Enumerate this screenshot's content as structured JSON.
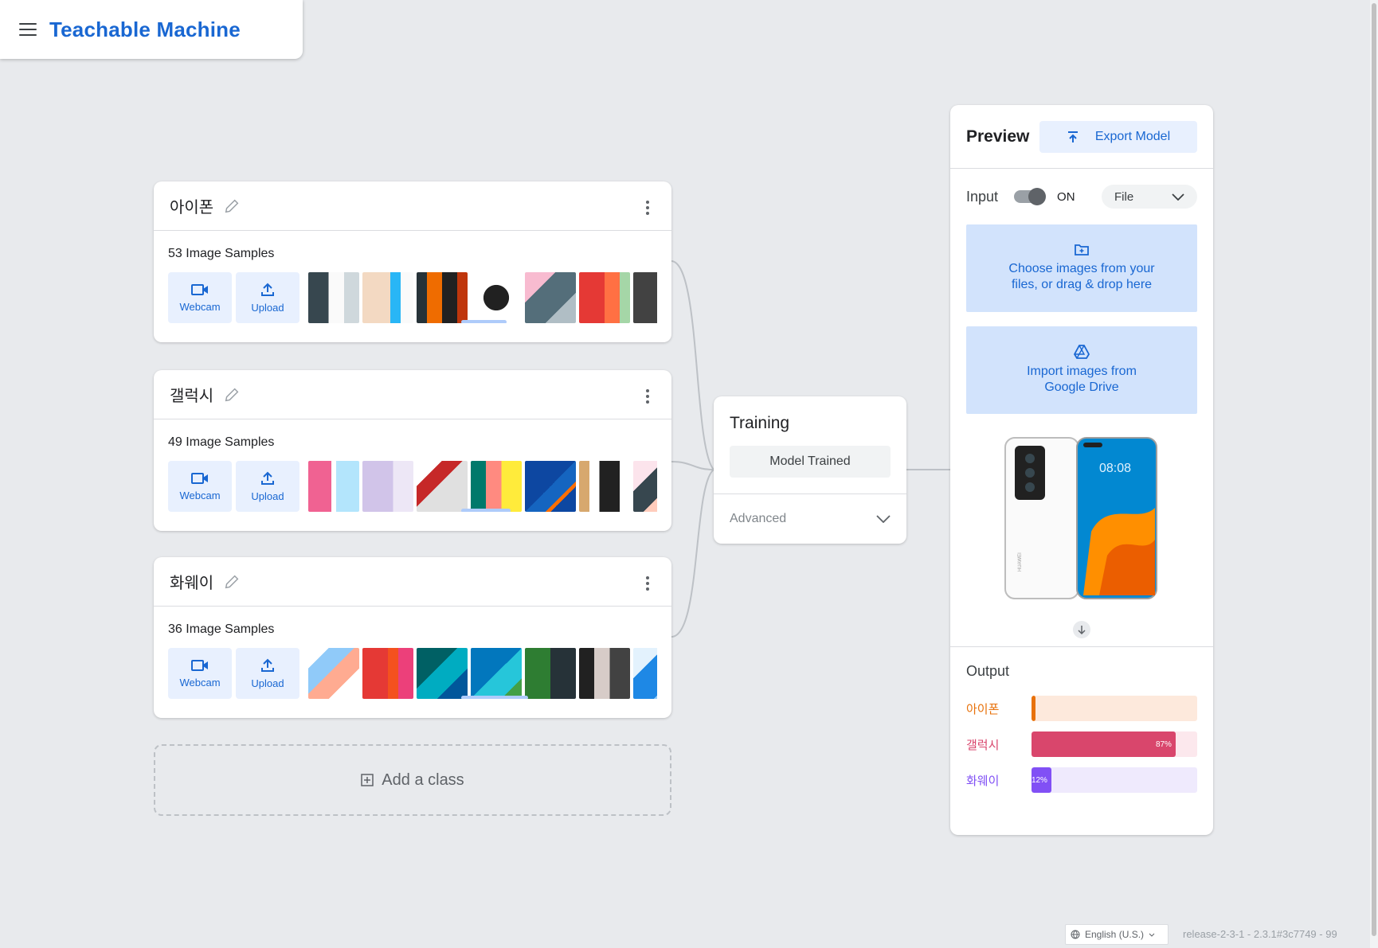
{
  "header": {
    "title": "Teachable Machine"
  },
  "classes": [
    {
      "name": "아이폰",
      "samples": "53 Image Samples"
    },
    {
      "name": "갤럭시",
      "samples": "49 Image Samples"
    },
    {
      "name": "화웨이",
      "samples": "36 Image Samples"
    }
  ],
  "sources": {
    "webcam": "Webcam",
    "upload": "Upload"
  },
  "add_class": "Add a class",
  "training": {
    "title": "Training",
    "status": "Model Trained",
    "advanced": "Advanced"
  },
  "preview": {
    "title": "Preview",
    "export": "Export Model",
    "input_label": "Input",
    "toggle": "ON",
    "input_source": "File",
    "choose_files_line1": "Choose images from your",
    "choose_files_line2": "files, or drag & drop here",
    "drive_line1": "Import images from",
    "drive_line2": "Google Drive",
    "phone_time": "08:08",
    "phone_brand": "HUAWEI"
  },
  "output": {
    "title": "Output",
    "bars": [
      {
        "label": "아이폰",
        "percent": 1,
        "text": "",
        "color": "#e8710a",
        "track": "#fde9dc"
      },
      {
        "label": "갤럭시",
        "percent": 87,
        "text": "87%",
        "color": "#d9466c",
        "track": "#fce8ed"
      },
      {
        "label": "화웨이",
        "percent": 12,
        "text": "12%",
        "color": "#8150f5",
        "track": "#efeafd"
      }
    ]
  },
  "footer": {
    "language": "English (U.S.)",
    "release": "release-2-3-1 - 2.3.1#3c7749 - 99"
  }
}
